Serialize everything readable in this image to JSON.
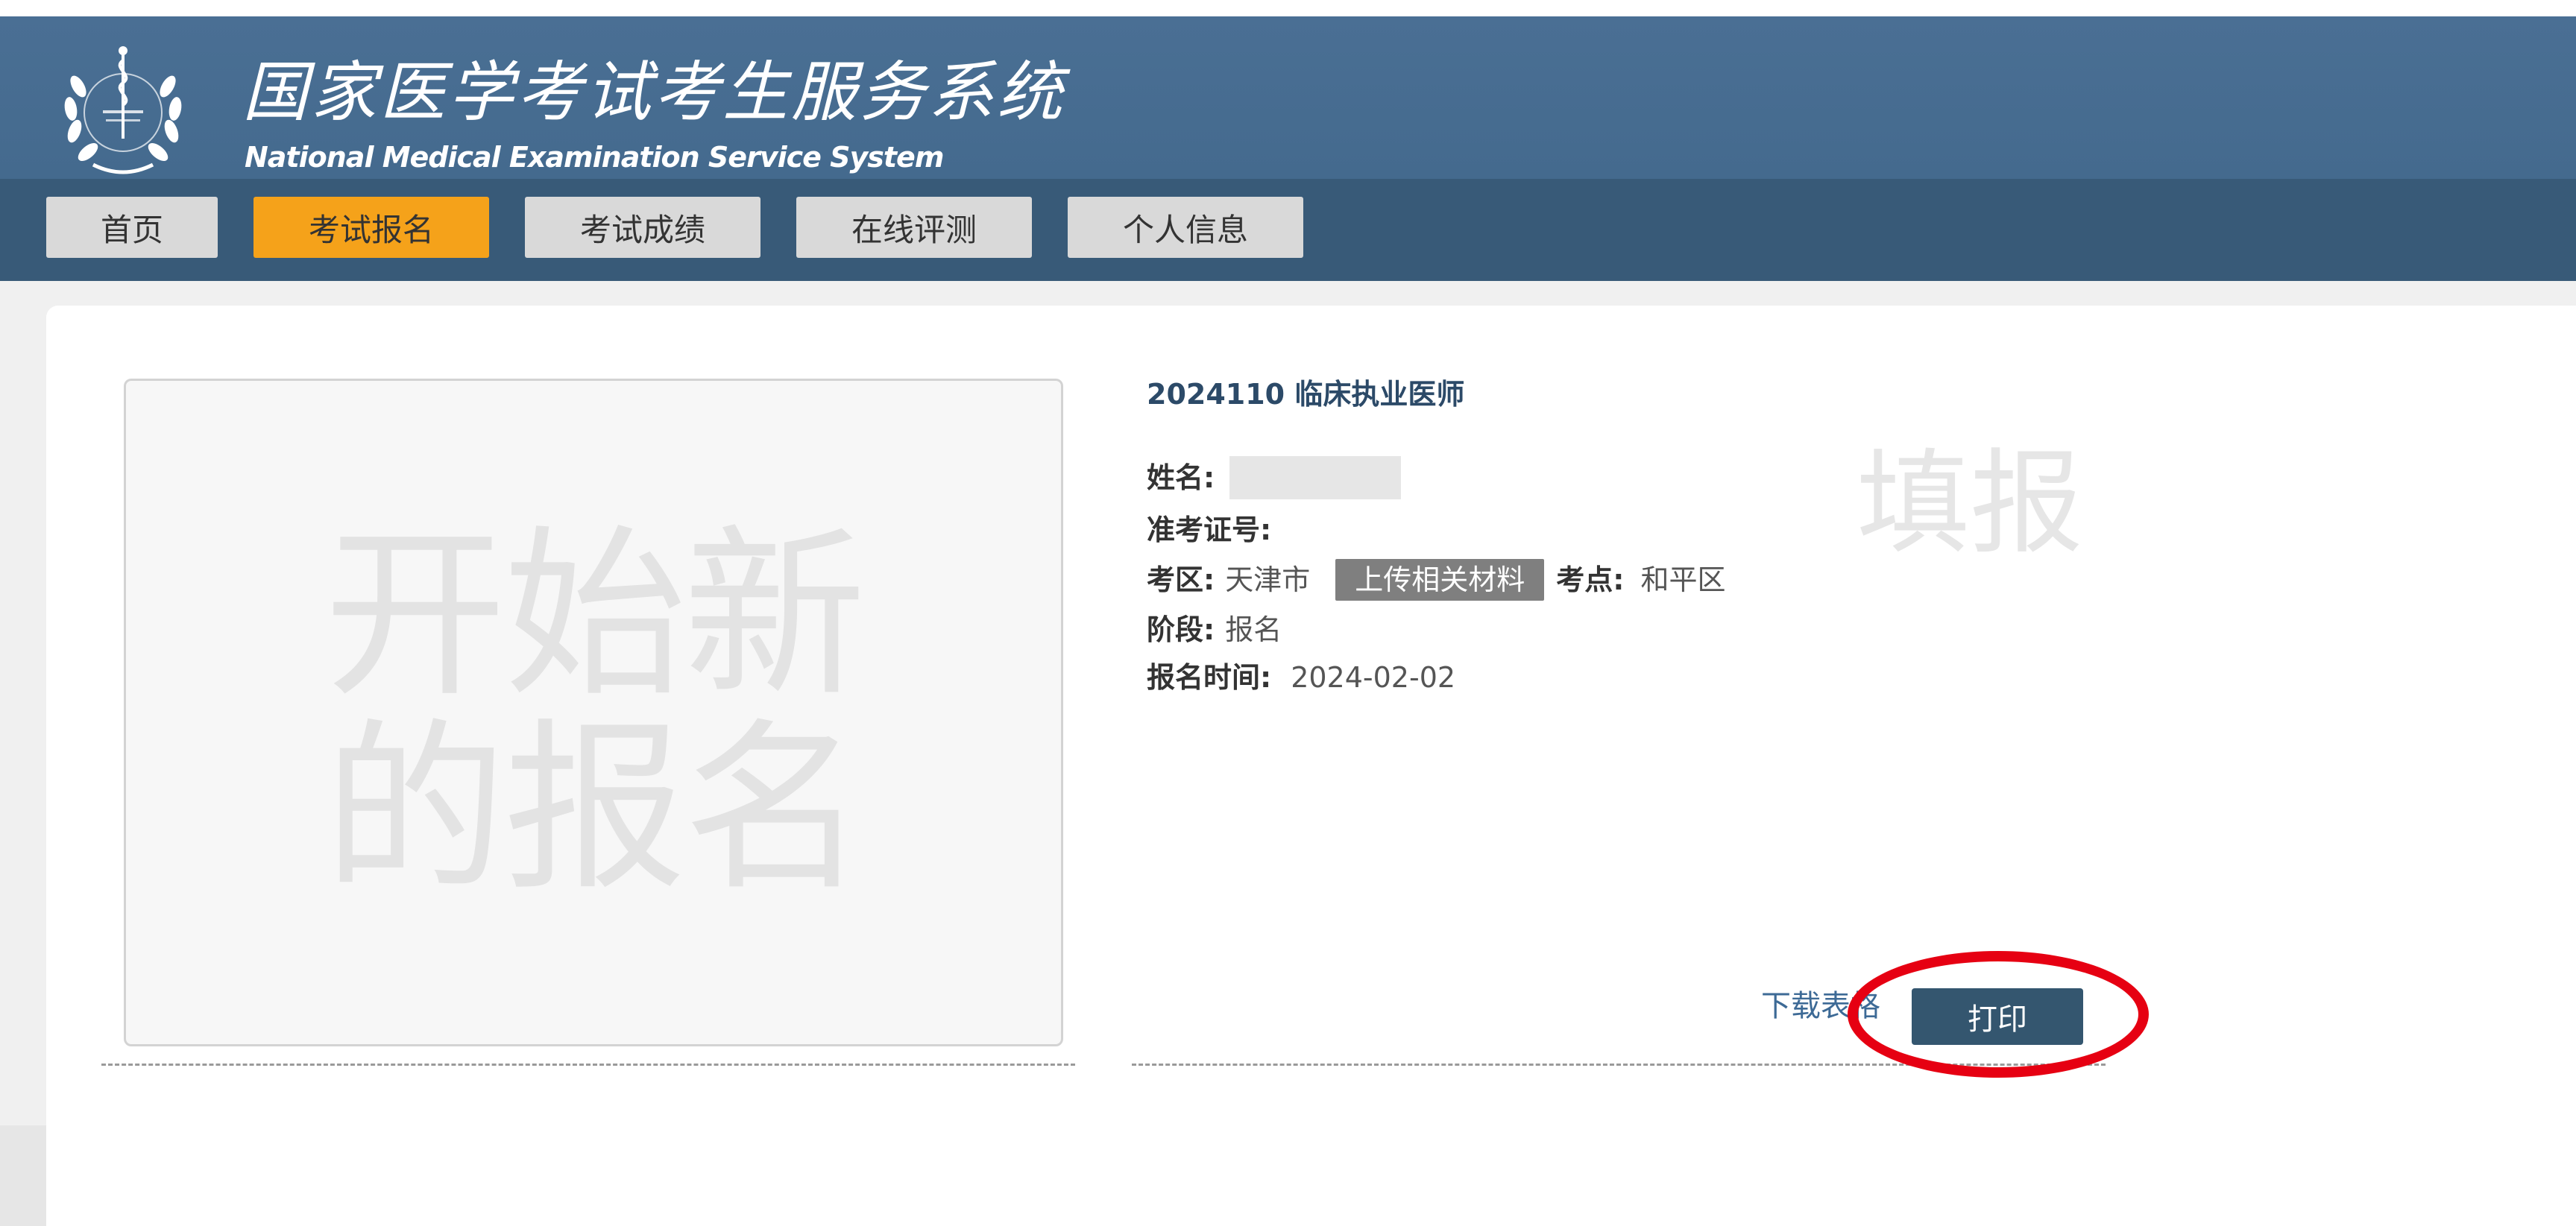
{
  "header": {
    "title_cn": "国家医学考试考生服务系统",
    "title_en": "National Medical Examination Service System",
    "logo_icon": "caduceus-laurel-emblem-icon"
  },
  "nav": {
    "tabs": [
      {
        "label": "首页",
        "active": false
      },
      {
        "label": "考试报名",
        "active": true
      },
      {
        "label": "考试成绩",
        "active": false
      },
      {
        "label": "在线评测",
        "active": false
      },
      {
        "label": "个人信息",
        "active": false
      }
    ]
  },
  "new_registration": {
    "line1": "开始新",
    "line2": "的报名"
  },
  "registration": {
    "exam_title": "2024110 临床执业医师",
    "name_label": "姓名:",
    "ticket_label": "准考证号:",
    "region_label": "考区:",
    "region_value": "天津市",
    "upload_button": "上传相关材料",
    "site_label": "考点:",
    "site_value": "和平区",
    "stage_label": "阶段:",
    "stage_value": "报名",
    "time_label": "报名时间:",
    "time_value": "2024-02-02",
    "watermark": "填报",
    "download_link": "下载表格",
    "print_button": "打印"
  },
  "colors": {
    "header_bg": "#4a6f94",
    "nav_bg": "#385a78",
    "active_tab": "#f5a21a",
    "print_button": "#34566f",
    "annotation": "#e60012"
  }
}
